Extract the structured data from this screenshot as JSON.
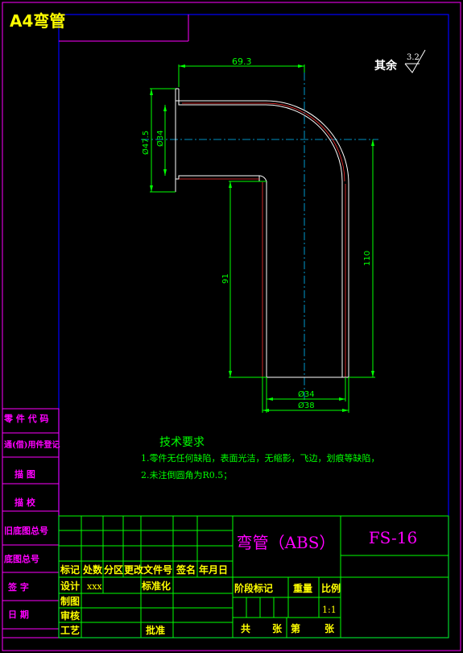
{
  "header": {
    "label": "A4弯管"
  },
  "roughness": {
    "label": "其余",
    "value": "3.2"
  },
  "dimensions": {
    "top_width": "69.3",
    "outer_flange_dia": "Ø47.5",
    "inner_dia_top": "Ø34",
    "vertical_inner": "91",
    "overall_height": "110",
    "bottom_inner_dia": "Ø34",
    "bottom_outer_dia": "Ø38"
  },
  "tech_requirements": {
    "title": "技术要求",
    "items": [
      "1.零件无任何缺陷，表面光洁，无缩影，飞边，划痕等缺陷，",
      "2.未注倒圆角为R0.5；"
    ]
  },
  "left_strip": {
    "labels": [
      "零 件 代 码",
      "通(借)用件登记",
      "描  图",
      "描  校",
      "旧底图总号",
      "底图总号",
      "签  字",
      "日  期"
    ]
  },
  "title_block": {
    "part_name": "弯管（ABS）",
    "drawing_no": "FS-16",
    "row_labels": [
      "标记",
      "处数",
      "分区",
      "更改文件号",
      "签名",
      "年月日"
    ],
    "design_label": "设计",
    "design_value": "xxx",
    "standardize_label": "标准化",
    "draw_label": "制图",
    "check_label": "审核",
    "process_label": "工艺",
    "approve_label": "批准",
    "stage_label": "阶段标记",
    "weight_label": "重量",
    "scale_label": "比例",
    "scale_value": "1:1",
    "total_label": "共",
    "sheet_label": "张",
    "page_label": "第",
    "page_sheet_label": "张"
  }
}
